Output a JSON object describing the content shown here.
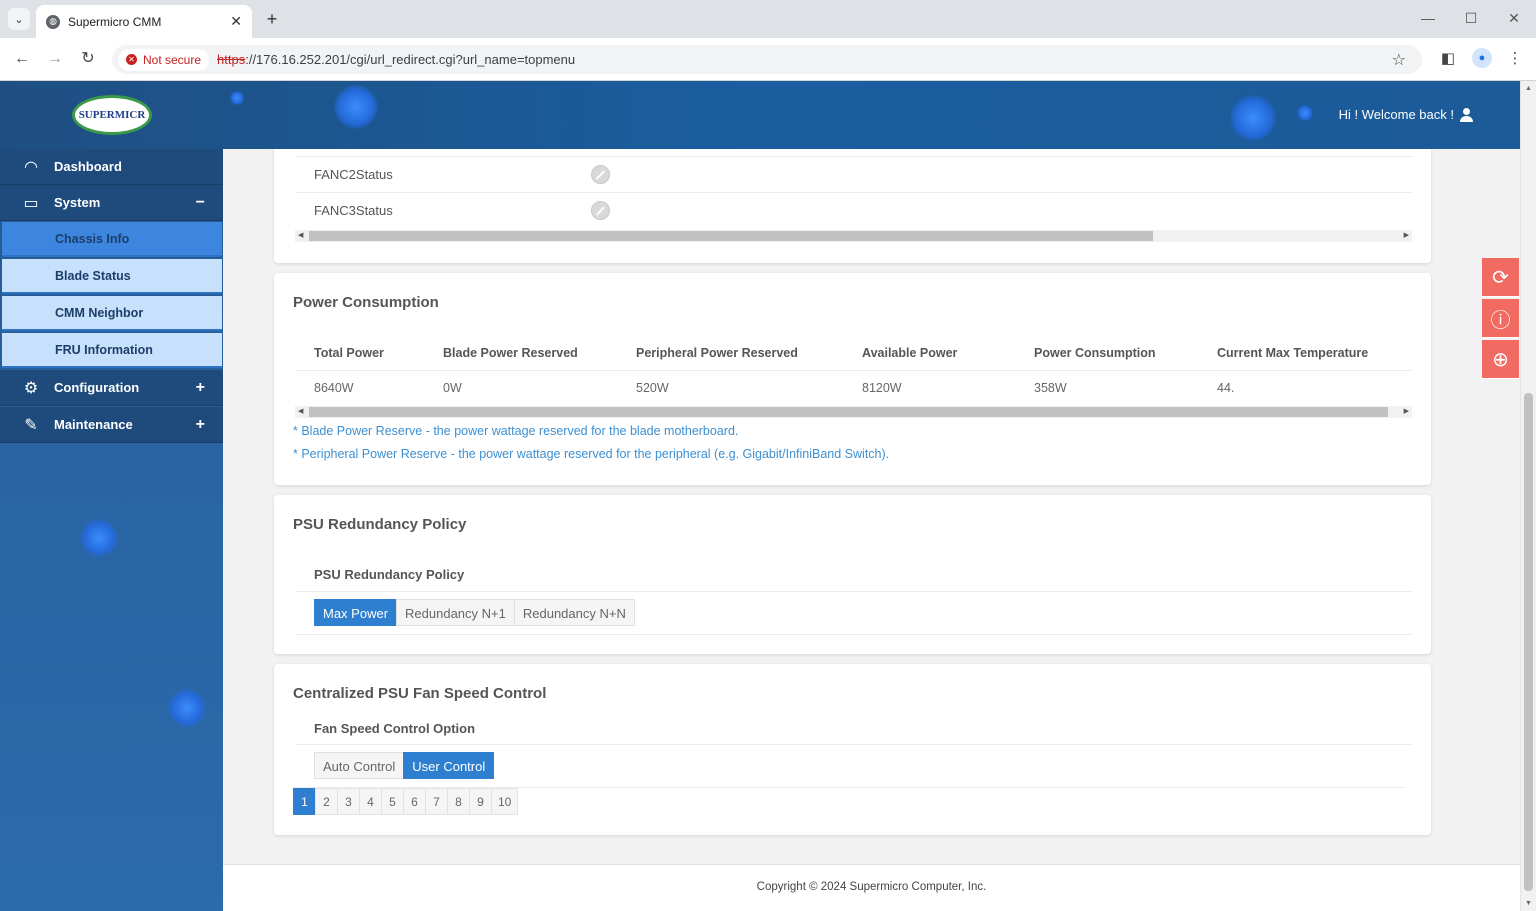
{
  "browser": {
    "tab_title": "Supermicro CMM",
    "new_tab": "+",
    "close_tab": "✕",
    "security_label": "Not secure",
    "url_scheme": "https",
    "url_rest": "://176.16.252.201/cgi/url_redirect.cgi?url_name=topmenu",
    "minimize": "—",
    "maximize": "☐",
    "close_window": "✕"
  },
  "header": {
    "logo_text": "SUPERMICR",
    "welcome": "Hi ! Welcome back !"
  },
  "sidebar": {
    "items": [
      {
        "label": "Dashboard",
        "icon": "dashboard-icon",
        "toggle": ""
      },
      {
        "label": "System",
        "icon": "laptop-icon",
        "toggle": "−"
      },
      {
        "label": "Configuration",
        "icon": "gear-icon",
        "toggle": "+"
      },
      {
        "label": "Maintenance",
        "icon": "wrench-icon",
        "toggle": "+"
      }
    ],
    "system_sub": [
      "Chassis Info",
      "Blade Status",
      "CMM Neighbor",
      "FRU Information"
    ],
    "active_sub": "Chassis Info"
  },
  "fan_card": {
    "rows": [
      {
        "label": "FANC2Status"
      },
      {
        "label": "FANC3Status"
      }
    ]
  },
  "power": {
    "title": "Power Consumption",
    "headers": [
      "Total Power",
      "Blade Power Reserved",
      "Peripheral Power Reserved",
      "Available Power",
      "Power Consumption",
      "Current Max Temperature"
    ],
    "values": [
      "8640W",
      "0W",
      "520W",
      "8120W",
      "358W",
      "44."
    ],
    "note1": "* Blade Power Reserve - the power wattage reserved for the blade motherboard.",
    "note2": "* Peripheral Power Reserve - the power wattage reserved for the peripheral (e.g. Gigabit/InfiniBand Switch)."
  },
  "psu": {
    "title": "PSU Redundancy Policy",
    "label": "PSU Redundancy Policy",
    "options": [
      "Max Power",
      "Redundancy N+1",
      "Redundancy N+N"
    ],
    "selected": "Max Power"
  },
  "fan_speed": {
    "title": "Centralized PSU Fan Speed Control",
    "label": "Fan Speed Control Option",
    "options": [
      "Auto Control",
      "User Control"
    ],
    "selected": "User Control",
    "pages": [
      "1",
      "2",
      "3",
      "4",
      "5",
      "6",
      "7",
      "8",
      "9",
      "10"
    ],
    "current_page": "1"
  },
  "footer": {
    "copyright": "Copyright © 2024 Supermicro Computer, Inc."
  },
  "colors": {
    "accent": "#2f7fd0",
    "float_tools": "#f26b63",
    "note_text": "#3d8fd1"
  }
}
